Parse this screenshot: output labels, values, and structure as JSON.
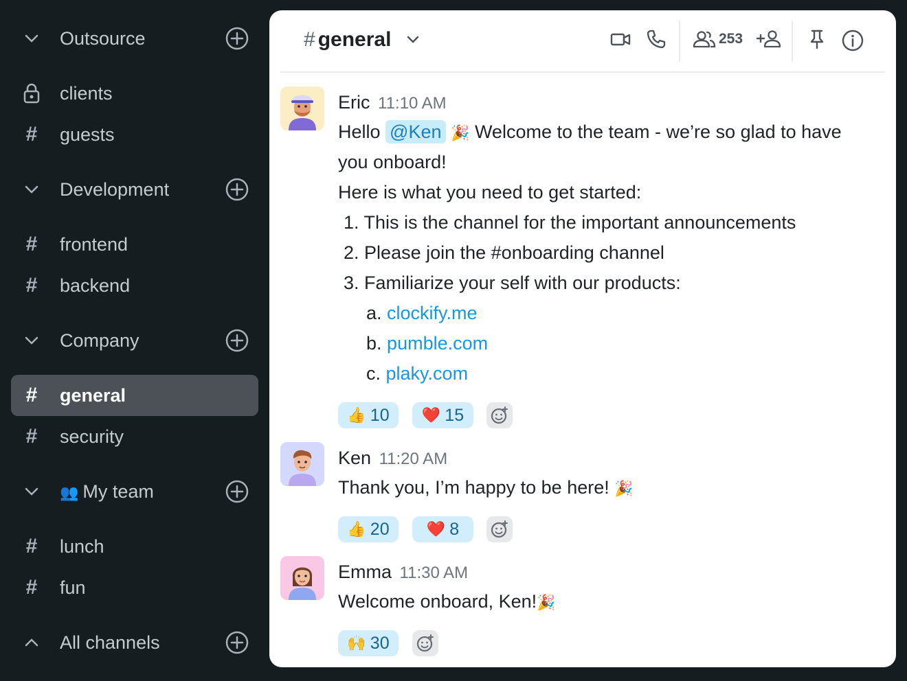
{
  "sidebar": {
    "sections": [
      {
        "label": "Outsource",
        "channels": [
          {
            "label": "clients",
            "icon": "lock-icon"
          },
          {
            "label": "guests",
            "icon": "hash-icon"
          }
        ]
      },
      {
        "label": "Development",
        "channels": [
          {
            "label": "frontend",
            "icon": "hash-icon"
          },
          {
            "label": "backend",
            "icon": "hash-icon"
          }
        ]
      },
      {
        "label": "Company",
        "channels": [
          {
            "label": "general",
            "icon": "hash-icon",
            "active": true
          },
          {
            "label": "security",
            "icon": "hash-icon"
          }
        ]
      },
      {
        "label": "My team",
        "emoji": "👥",
        "channels": [
          {
            "label": "lunch",
            "icon": "hash-icon"
          },
          {
            "label": "fun",
            "icon": "hash-icon"
          }
        ]
      }
    ],
    "all_channels": "All channels",
    "hash": "#"
  },
  "header": {
    "hash": "#",
    "channel_name": "general",
    "member_count": "253"
  },
  "messages": [
    {
      "author": "Eric",
      "time": "11:10 AM",
      "hello": "Hello",
      "mention": "@Ken",
      "party": "🎉",
      "line1_rest": "Welcome to the team - we’re so glad to have",
      "line2": "you onboard!",
      "line3": "Here is what you need to get started:",
      "items": [
        {
          "num": "1.",
          "text": "This is the channel for the important announcements"
        },
        {
          "num": "2.",
          "text": "Please join the  #onboarding channel"
        },
        {
          "num": "3.",
          "text": "Familiarize your self with our products:"
        }
      ],
      "subitems": [
        {
          "letter": "a.",
          "link": "clockify.me"
        },
        {
          "letter": "b.",
          "link": "pumble.com"
        },
        {
          "letter": "c.",
          "link": "plaky.com"
        }
      ],
      "reactions": [
        {
          "emoji": "👍",
          "count": "10"
        },
        {
          "emoji": "❤️",
          "count": "15"
        }
      ]
    },
    {
      "author": "Ken",
      "time": "11:20 AM",
      "text": "Thank you, I’m happy to be here!",
      "party": "🎉",
      "reactions": [
        {
          "emoji": "👍",
          "count": "20"
        },
        {
          "emoji": "❤️",
          "count": "8"
        }
      ]
    },
    {
      "author": "Emma",
      "time": "11:30 AM",
      "text": "Welcome onboard, Ken!",
      "party": "🎉",
      "reactions": [
        {
          "emoji": "🙌",
          "count": "30"
        }
      ]
    }
  ],
  "colors": {
    "sidebar_bg": "#161d20",
    "active_channel_bg": "#4b5156",
    "reaction_bg": "#d2eefc",
    "link": "#1a95e0",
    "mention_bg": "#c9ecfb"
  }
}
